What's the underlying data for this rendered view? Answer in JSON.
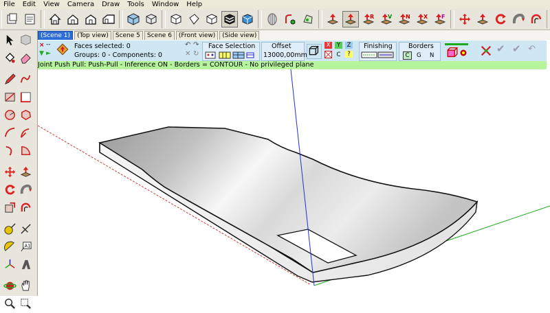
{
  "menu": [
    "File",
    "Edit",
    "View",
    "Camera",
    "Draw",
    "Tools",
    "Window",
    "Help"
  ],
  "scene_tabs": [
    "(Scene 1)",
    "(Top view)",
    "Scene 5",
    "Scene 6",
    "(Front view)",
    "(Side view)"
  ],
  "panel": {
    "faces_selected": "Faces selected: 0",
    "groups_components": "Groups: 0 - Components: 0",
    "close_glyph": "×",
    "dashes": "--",
    "face_selection_label": "Face Selection",
    "offset_label": "Offset",
    "offset_value": "13000,00mm",
    "axis_x": "X",
    "axis_y": "Y",
    "axis_z": "Z",
    "axis_c": "C",
    "axis_q": "?",
    "finishing_label": "Finishing",
    "borders_label": "Borders",
    "border_c": "C",
    "border_g": "G",
    "border_n": "N"
  },
  "status_text": "Joint Push Pull: Push-Pull - Inference ON - Borders = CONTOUR - No privileged plane",
  "colors": {
    "panel_bg": "#cfe6f3",
    "status_bg": "#b6f59c",
    "active_tab": "#2d6dd6",
    "axis_blue": "#1f2fd6",
    "axis_green": "#1caa1c",
    "axis_red": "#d43a3a"
  },
  "toolbar_icons": [
    "new-file-icon",
    "open-file-icon",
    "home-view-icon",
    "house-icon",
    "house-front-icon",
    "house-side-icon",
    "iso-cube-icon",
    "cube-outline-icon",
    "cube-top-icon",
    "cube-white-icon",
    "cube-dark-icon",
    "cube-shaded-icon",
    "shell-icon",
    "joint-icon",
    "polygon-icon",
    "push-pull-red-icon",
    "push-pull-select-icon",
    "push-pull-r-icon",
    "push-pull-v-icon",
    "push-pull-n-icon",
    "push-pull-x-icon",
    "push-pull-f-icon",
    "move-icon",
    "push-pull-icon",
    "rotate-icon",
    "follow-me-icon",
    "offset-icon"
  ],
  "left_icons": [
    "select-arrow-icon",
    "component-icon",
    "paint-bucket-icon",
    "eraser-icon",
    "pencil-icon",
    "freehand-icon",
    "rectangle-icon",
    "rotated-rect-icon",
    "circle-icon",
    "polygon-tool-icon",
    "arc-icon",
    "arc2-icon",
    "arc3-icon",
    "pie-icon",
    "move-icon",
    "push-pull-icon",
    "rotate-icon",
    "follow-me-icon",
    "scale-icon",
    "offset-icon",
    "tape-measure-icon",
    "dimension-icon",
    "protractor-icon",
    "text-icon",
    "axes-icon",
    "3d-text-icon",
    "orbit-icon",
    "pan-icon"
  ]
}
